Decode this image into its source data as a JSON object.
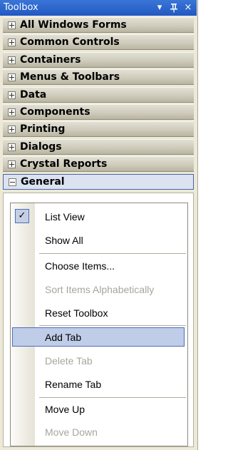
{
  "titlebar": {
    "title": "Toolbox",
    "dropdown_icon": "▾",
    "pin_icon": "ᵻ",
    "close_icon": "×"
  },
  "tabs": [
    {
      "label": "All Windows Forms",
      "expanded": false
    },
    {
      "label": "Common Controls",
      "expanded": false
    },
    {
      "label": "Containers",
      "expanded": false
    },
    {
      "label": "Menus & Toolbars",
      "expanded": false
    },
    {
      "label": "Data",
      "expanded": false
    },
    {
      "label": "Components",
      "expanded": false
    },
    {
      "label": "Printing",
      "expanded": false
    },
    {
      "label": "Dialogs",
      "expanded": false
    },
    {
      "label": "Crystal Reports",
      "expanded": false
    },
    {
      "label": "General",
      "expanded": true
    }
  ],
  "context_menu": {
    "items": [
      {
        "label": "List View",
        "checked": true,
        "enabled": true
      },
      {
        "label": "Show All",
        "enabled": true
      },
      {
        "label": "Choose Items...",
        "enabled": true
      },
      {
        "label": "Sort Items Alphabetically",
        "enabled": false
      },
      {
        "label": "Reset Toolbox",
        "enabled": true
      },
      {
        "label": "Add Tab",
        "enabled": true,
        "selected": true
      },
      {
        "label": "Delete Tab",
        "enabled": false
      },
      {
        "label": "Rename Tab",
        "enabled": true
      },
      {
        "label": "Move Up",
        "enabled": true
      },
      {
        "label": "Move Down",
        "enabled": false
      }
    ],
    "check_glyph": "✓"
  },
  "colors": {
    "titlebar": "#2a63cf",
    "highlight": "#c0cde8",
    "highlight_border": "#4e6cb5",
    "disabled_text": "#a7a69c"
  }
}
